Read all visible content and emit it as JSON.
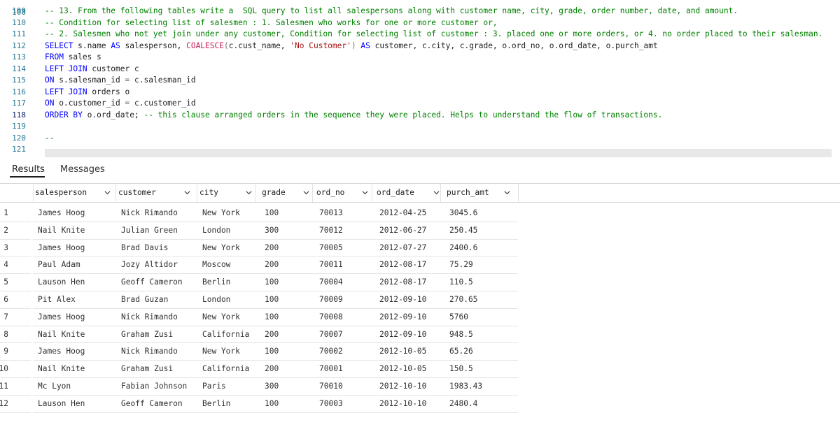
{
  "editor": {
    "partial_top_number": "108",
    "lines": [
      {
        "number": "109",
        "segments": [
          {
            "cls": "c-comment",
            "text": "-- 13. From the following tables write a  SQL query to list all salespersons along with customer name, city, grade, order number, date, and amount."
          }
        ]
      },
      {
        "number": "110",
        "segments": [
          {
            "cls": "c-comment",
            "text": "-- Condition for selecting list of salesmen : 1. Salesmen who works for one or more customer or,"
          }
        ]
      },
      {
        "number": "111",
        "segments": [
          {
            "cls": "c-comment",
            "text": "-- 2. Salesmen who not yet join under any customer, Condition for selecting list of customer : 3. placed one or more orders, or 4. no order placed to their salesman."
          }
        ]
      },
      {
        "number": "112",
        "segments": [
          {
            "cls": "c-kw",
            "text": "SELECT"
          },
          {
            "cls": "c-plain",
            "text": " s.name "
          },
          {
            "cls": "c-kw",
            "text": "AS"
          },
          {
            "cls": "c-plain",
            "text": " salesperson, "
          },
          {
            "cls": "c-fn2",
            "text": "COALESCE"
          },
          {
            "cls": "c-op",
            "text": "("
          },
          {
            "cls": "c-plain",
            "text": "c.cust_name, "
          },
          {
            "cls": "c-str",
            "text": "'No Customer'"
          },
          {
            "cls": "c-op",
            "text": ")"
          },
          {
            "cls": "c-plain",
            "text": " "
          },
          {
            "cls": "c-kw",
            "text": "AS"
          },
          {
            "cls": "c-plain",
            "text": " customer, c.city, c.grade, o.ord_no, o.ord_date, o.purch_amt"
          }
        ]
      },
      {
        "number": "113",
        "segments": [
          {
            "cls": "c-kw",
            "text": "FROM"
          },
          {
            "cls": "c-plain",
            "text": " sales s"
          }
        ]
      },
      {
        "number": "114",
        "segments": [
          {
            "cls": "c-kw",
            "text": "LEFT JOIN"
          },
          {
            "cls": "c-plain",
            "text": " customer c"
          }
        ]
      },
      {
        "number": "115",
        "segments": [
          {
            "cls": "c-kw",
            "text": "ON"
          },
          {
            "cls": "c-plain",
            "text": " s.salesman_id "
          },
          {
            "cls": "c-op",
            "text": "="
          },
          {
            "cls": "c-plain",
            "text": " c.salesman_id"
          }
        ]
      },
      {
        "number": "116",
        "segments": [
          {
            "cls": "c-kw",
            "text": "LEFT JOIN"
          },
          {
            "cls": "c-plain",
            "text": " orders o"
          }
        ]
      },
      {
        "number": "117",
        "segments": [
          {
            "cls": "c-kw",
            "text": "ON"
          },
          {
            "cls": "c-plain",
            "text": " o.customer_id "
          },
          {
            "cls": "c-op",
            "text": "="
          },
          {
            "cls": "c-plain",
            "text": " c.customer_id"
          }
        ]
      },
      {
        "number": "118",
        "current": true,
        "segments": [
          {
            "cls": "c-kw",
            "text": "ORDER BY"
          },
          {
            "cls": "c-plain",
            "text": " o.ord_date; "
          },
          {
            "cls": "c-comment",
            "text": "-- this clause arranged orders in the sequence they were placed. Helps to understand the flow of transactions."
          }
        ]
      },
      {
        "number": "119",
        "segments": []
      },
      {
        "number": "120",
        "segments": [
          {
            "cls": "c-comment",
            "text": "--"
          }
        ]
      },
      {
        "number": "121",
        "segments": []
      }
    ]
  },
  "panel": {
    "tabs": [
      {
        "label": "Results",
        "active": true
      },
      {
        "label": "Messages",
        "active": false
      }
    ]
  },
  "grid": {
    "columns": [
      "salesperson",
      "customer",
      "city",
      "grade",
      "ord_no",
      "ord_date",
      "purch_amt"
    ],
    "rows": [
      [
        "James Hoog",
        "Nick Rimando",
        "New York",
        "100",
        "70013",
        "2012-04-25",
        "3045.6"
      ],
      [
        "Nail Knite",
        "Julian Green",
        "London",
        "300",
        "70012",
        "2012-06-27",
        "250.45"
      ],
      [
        "James Hoog",
        "Brad Davis",
        "New York",
        "200",
        "70005",
        "2012-07-27",
        "2400.6"
      ],
      [
        "Paul Adam",
        "Jozy Altidor",
        "Moscow",
        "200",
        "70011",
        "2012-08-17",
        "75.29"
      ],
      [
        "Lauson Hen",
        "Geoff Cameron",
        "Berlin",
        "100",
        "70004",
        "2012-08-17",
        "110.5"
      ],
      [
        "Pit Alex",
        "Brad Guzan",
        "London",
        "100",
        "70009",
        "2012-09-10",
        "270.65"
      ],
      [
        "James Hoog",
        "Nick Rimando",
        "New York",
        "100",
        "70008",
        "2012-09-10",
        "5760"
      ],
      [
        "Nail Knite",
        "Graham Zusi",
        "California",
        "200",
        "70007",
        "2012-09-10",
        "948.5"
      ],
      [
        "James Hoog",
        "Nick Rimando",
        "New York",
        "100",
        "70002",
        "2012-10-05",
        "65.26"
      ],
      [
        "Nail Knite",
        "Graham Zusi",
        "California",
        "200",
        "70001",
        "2012-10-05",
        "150.5"
      ],
      [
        "Mc Lyon",
        "Fabian Johnson",
        "Paris",
        "300",
        "70010",
        "2012-10-10",
        "1983.43"
      ],
      [
        "Lauson Hen",
        "Geoff Cameron",
        "Berlin",
        "100",
        "70003",
        "2012-10-10",
        "2480.4"
      ]
    ],
    "row_numbers": [
      "1",
      "2",
      "3",
      "4",
      "5",
      "6",
      "7",
      "8",
      "9",
      "10",
      "11",
      "12"
    ]
  }
}
